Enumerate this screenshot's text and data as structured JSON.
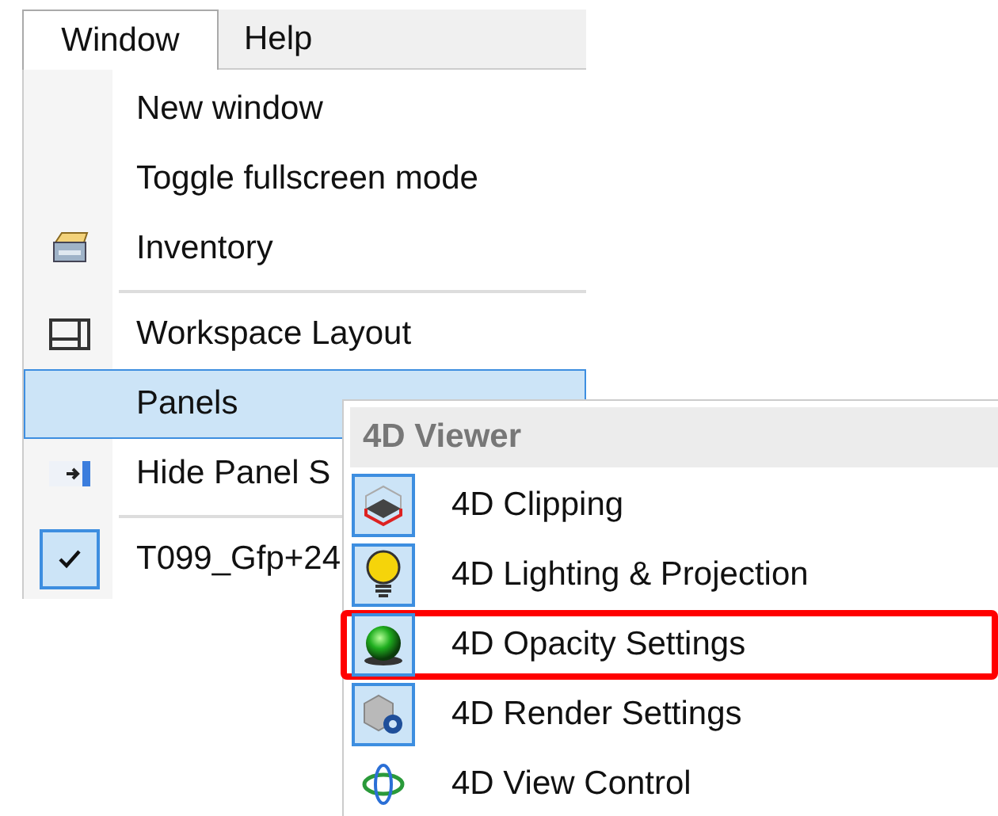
{
  "menu_bar": [
    {
      "label": "Window",
      "selected": true
    },
    {
      "label": "Help",
      "selected": false
    }
  ],
  "menu": [
    {
      "kind": "item",
      "label": "New window",
      "selected": false,
      "checked": false
    },
    {
      "kind": "item",
      "label": "Toggle fullscreen mode",
      "selected": false,
      "checked": false
    },
    {
      "kind": "item",
      "label": "Inventory",
      "selected": false,
      "checked": false
    },
    {
      "kind": "separator"
    },
    {
      "kind": "item",
      "label": "Workspace Layout",
      "selected": false,
      "checked": false
    },
    {
      "kind": "item",
      "label": "Panels",
      "selected": true,
      "checked": false
    },
    {
      "kind": "item",
      "label": "Hide Panel S",
      "selected": false,
      "checked": false
    },
    {
      "kind": "separator"
    },
    {
      "kind": "item",
      "label": "T099_Gfp+24",
      "selected": false,
      "checked": true
    }
  ],
  "submenu": {
    "header": "4D Viewer",
    "items": [
      {
        "label": "4D Clipping",
        "checked": true,
        "highlighted": false
      },
      {
        "label": "4D Lighting & Projection",
        "checked": true,
        "highlighted": false
      },
      {
        "label": "4D Opacity Settings",
        "checked": true,
        "highlighted": true
      },
      {
        "label": "4D Render Settings",
        "checked": true,
        "highlighted": false
      },
      {
        "label": "4D View Control",
        "checked": false,
        "highlighted": false
      }
    ]
  }
}
